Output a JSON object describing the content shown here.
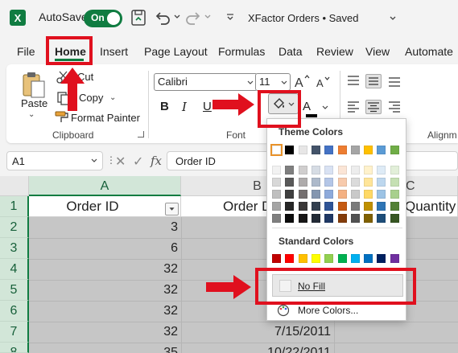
{
  "titlebar": {
    "logo_letter": "X",
    "autosave_label": "AutoSave",
    "autosave_state": "On",
    "document_title": "XFactor Orders • Saved"
  },
  "tabs": [
    "File",
    "Home",
    "Insert",
    "Page Layout",
    "Formulas",
    "Data",
    "Review",
    "View",
    "Automate"
  ],
  "active_tab": "Home",
  "ribbon": {
    "clipboard": {
      "paste": "Paste",
      "cut": "Cut",
      "copy": "Copy",
      "format_painter": "Format Painter",
      "group_label": "Clipboard"
    },
    "font": {
      "font_name": "Calibri",
      "font_size": "11",
      "bold": "B",
      "italic": "I",
      "underline": "U",
      "font_color_glyph": "A",
      "group_label": "Font"
    },
    "alignment": {
      "group_label": "Alignm"
    }
  },
  "formula_bar": {
    "name_box": "A1",
    "fx": "fx",
    "content": "Order ID"
  },
  "grid": {
    "columns": [
      "A",
      "B",
      "C"
    ],
    "rows": [
      "1",
      "2",
      "3",
      "4",
      "5",
      "6",
      "7",
      "8"
    ],
    "header_row": [
      "Order ID",
      "Order D",
      "Quantity"
    ],
    "col_a_values": [
      "3",
      "6",
      "32",
      "32",
      "32",
      "32",
      "35"
    ],
    "col_b_values": [
      "7/15/2011",
      "10/22/2011"
    ]
  },
  "fill_dropdown": {
    "theme_heading": "Theme Colors",
    "standard_heading": "Standard Colors",
    "no_fill": "No Fill",
    "more_colors": "More Colors...",
    "theme_top": [
      "#ffffff",
      "#000000",
      "#e7e6e6",
      "#44546a",
      "#4472c4",
      "#ed7d31",
      "#a5a5a5",
      "#ffc000",
      "#5b9bd5",
      "#70ad47"
    ],
    "theme_shades": [
      [
        "#f2f2f2",
        "#7f7f7f",
        "#d0cece",
        "#d6dce4",
        "#d9e2f3",
        "#fbe5d6",
        "#ededed",
        "#fff2cc",
        "#deebf6",
        "#e2efd9"
      ],
      [
        "#d8d8d8",
        "#595959",
        "#aeabab",
        "#adb9ca",
        "#b4c6e7",
        "#f7caac",
        "#dbdbdb",
        "#ffe599",
        "#bdd7ee",
        "#c5e0b3"
      ],
      [
        "#bfbfbf",
        "#3f3f3f",
        "#757070",
        "#8496b0",
        "#8eaadb",
        "#f4b183",
        "#c9c9c9",
        "#ffd966",
        "#9cc3e5",
        "#a8d08d"
      ],
      [
        "#a5a5a5",
        "#262626",
        "#3a3838",
        "#323f4f",
        "#2f5496",
        "#c55a11",
        "#7b7b7b",
        "#bf9000",
        "#2e75b5",
        "#538135"
      ],
      [
        "#7f7f7f",
        "#0c0c0c",
        "#171616",
        "#222a35",
        "#1f3864",
        "#833c0b",
        "#525252",
        "#7f6000",
        "#1e4e79",
        "#375623"
      ]
    ],
    "standard": [
      "#c00000",
      "#ff0000",
      "#ffc000",
      "#ffff00",
      "#92d050",
      "#00b050",
      "#00b0f0",
      "#0070c0",
      "#002060",
      "#7030a0"
    ]
  },
  "colors": {
    "excel_green": "#107c41",
    "annotation_red": "#e0101e"
  }
}
